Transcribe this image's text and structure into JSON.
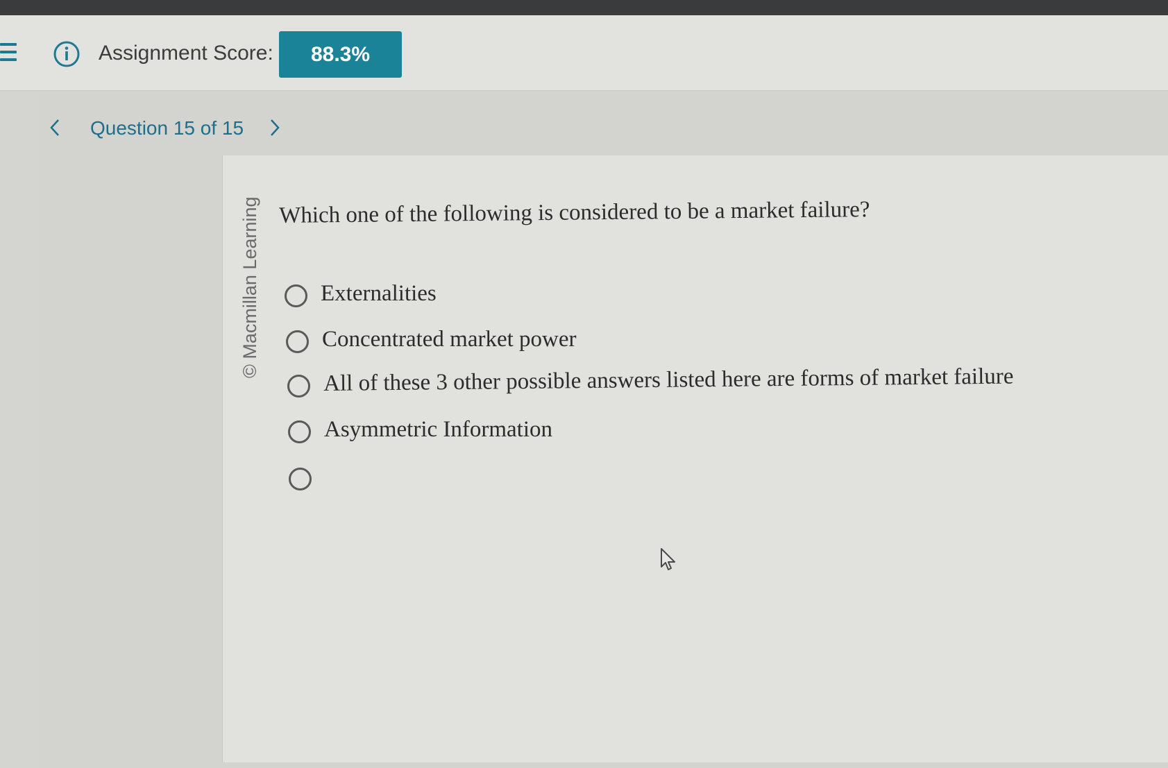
{
  "header": {
    "score_label": "Assignment Score:",
    "score_value": "88.3%",
    "accent_color": "#1b8398"
  },
  "nav": {
    "question_label": "Question 15 of 15"
  },
  "question": {
    "copyright": "© Macmillan Learning",
    "prompt": "Which one of the following is considered to be a market failure?",
    "options": [
      {
        "label": "Externalities",
        "selected": false
      },
      {
        "label": "Concentrated market power",
        "selected": false
      },
      {
        "label": "All of these 3 other possible answers listed here are forms of market failure",
        "selected": false
      },
      {
        "label": "Asymmetric Information",
        "selected": false
      },
      {
        "label": "",
        "selected": false
      }
    ]
  },
  "icons": {
    "menu": "hamburger-icon",
    "info": "info-icon",
    "prev": "chevron-left-icon",
    "next": "chevron-right-icon",
    "pointer": "mouse-cursor-icon"
  }
}
